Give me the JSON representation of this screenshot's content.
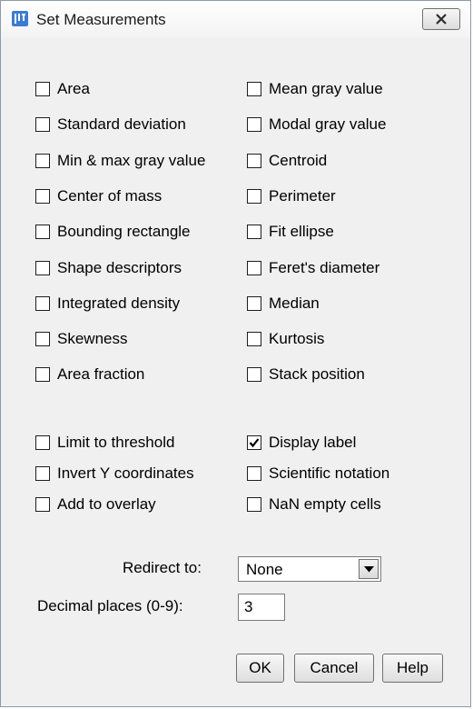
{
  "window": {
    "title": "Set Measurements",
    "close_label": "close"
  },
  "measurements": [
    {
      "label": "Area",
      "checked": false
    },
    {
      "label": "Mean gray value",
      "checked": false
    },
    {
      "label": "Standard deviation",
      "checked": false
    },
    {
      "label": "Modal gray value",
      "checked": false
    },
    {
      "label": "Min & max gray value",
      "checked": false
    },
    {
      "label": "Centroid",
      "checked": false
    },
    {
      "label": "Center of mass",
      "checked": false
    },
    {
      "label": "Perimeter",
      "checked": false
    },
    {
      "label": "Bounding rectangle",
      "checked": false
    },
    {
      "label": "Fit ellipse",
      "checked": false
    },
    {
      "label": "Shape descriptors",
      "checked": false
    },
    {
      "label": "Feret's diameter",
      "checked": false
    },
    {
      "label": "Integrated density",
      "checked": false
    },
    {
      "label": "Median",
      "checked": false
    },
    {
      "label": "Skewness",
      "checked": false
    },
    {
      "label": "Kurtosis",
      "checked": false
    },
    {
      "label": "Area fraction",
      "checked": false
    },
    {
      "label": "Stack position",
      "checked": false
    }
  ],
  "options": [
    {
      "label": "Limit to threshold",
      "checked": false
    },
    {
      "label": "Display label",
      "checked": true
    },
    {
      "label": "Invert Y coordinates",
      "checked": false
    },
    {
      "label": "Scientific notation",
      "checked": false
    },
    {
      "label": "Add to overlay",
      "checked": false
    },
    {
      "label": "NaN empty cells",
      "checked": false
    }
  ],
  "redirect": {
    "label": "Redirect to:",
    "value": "None"
  },
  "decimal": {
    "label": "Decimal places (0-9):",
    "value": "3"
  },
  "buttons": {
    "ok": "OK",
    "cancel": "Cancel",
    "help": "Help"
  }
}
